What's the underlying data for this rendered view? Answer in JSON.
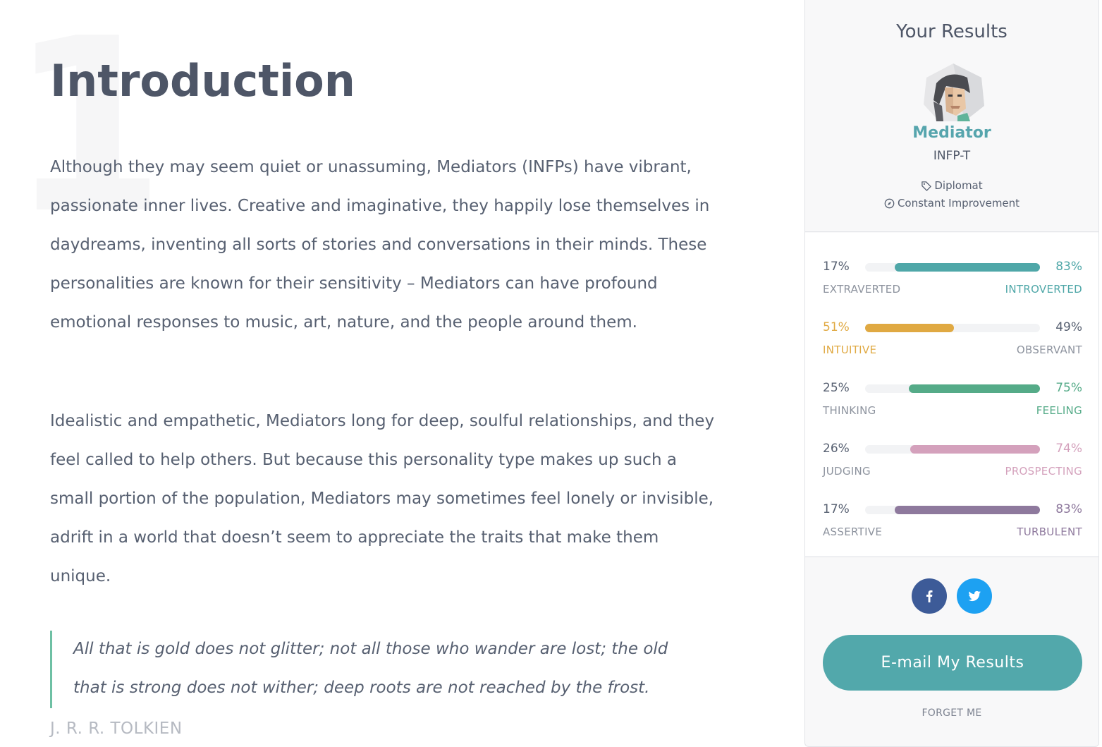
{
  "article": {
    "watermark_number": "1",
    "title": "Introduction",
    "paragraphs": [
      "Although they may seem quiet or unassuming, Mediators (INFPs) have vibrant, passionate inner lives. Creative and imaginative, they happily lose themselves in daydreams, inventing all sorts of stories and conversations in their minds. These personalities are known for their sensitivity – Mediators can have profound emotional responses to music, art, nature, and the people around them.",
      "Idealistic and empathetic, Mediators long for deep, soulful relationships, and they feel called to help others. But because this personality type makes up such a small portion of the population, Mediators may sometimes feel lonely or invisible, adrift in a world that doesn’t seem to appreciate the traits that make them unique."
    ],
    "quote": "All that is gold does not glitter; not all those who wander are lost; the old that is strong does not wither; deep roots are not reached by the frost.",
    "quote_author": "J. R. R. TOLKIEN"
  },
  "sidebar": {
    "title": "Your Results",
    "avatar_icon": "mediator-avatar-icon",
    "type_name": "Mediator",
    "type_code": "INFP-T",
    "role_icon": "tag-icon",
    "role": "Diplomat",
    "strategy_icon": "compass-icon",
    "strategy": "Constant Improvement",
    "traits": [
      {
        "left_pct": "17%",
        "right_pct": "83%",
        "left_label": "EXTRAVERTED",
        "right_label": "INTROVERTED",
        "dominant": "right",
        "left_fraction": 0.17,
        "right_fraction": 0.83,
        "color": "#4fa7a8"
      },
      {
        "left_pct": "51%",
        "right_pct": "49%",
        "left_label": "INTUITIVE",
        "right_label": "OBSERVANT",
        "dominant": "left",
        "left_fraction": 0.51,
        "right_fraction": 0.49,
        "color": "#e0a942"
      },
      {
        "left_pct": "25%",
        "right_pct": "75%",
        "left_label": "THINKING",
        "right_label": "FEELING",
        "dominant": "right",
        "left_fraction": 0.25,
        "right_fraction": 0.75,
        "color": "#55ab88"
      },
      {
        "left_pct": "26%",
        "right_pct": "74%",
        "left_label": "JUDGING",
        "right_label": "PROSPECTING",
        "dominant": "right",
        "left_fraction": 0.26,
        "right_fraction": 0.74,
        "color": "#d4a1bc"
      },
      {
        "left_pct": "17%",
        "right_pct": "83%",
        "left_label": "ASSERTIVE",
        "right_label": "TURBULENT",
        "dominant": "right",
        "left_fraction": 0.17,
        "right_fraction": 0.83,
        "color": "#8e799d"
      }
    ],
    "share": {
      "facebook_icon": "facebook-icon",
      "facebook_color": "#3d5b98",
      "twitter_icon": "twitter-icon",
      "twitter_color": "#1da1f2"
    },
    "email_button": "E-mail My Results",
    "email_button_color": "#52a8ab",
    "forget_link": "FORGET ME"
  },
  "colors": {
    "heading": "#4e5667",
    "body_text": "#576071",
    "accent_teal": "#56a5ad",
    "quote_border": "#6ec0a4",
    "muted_author": "#b6bac2"
  }
}
